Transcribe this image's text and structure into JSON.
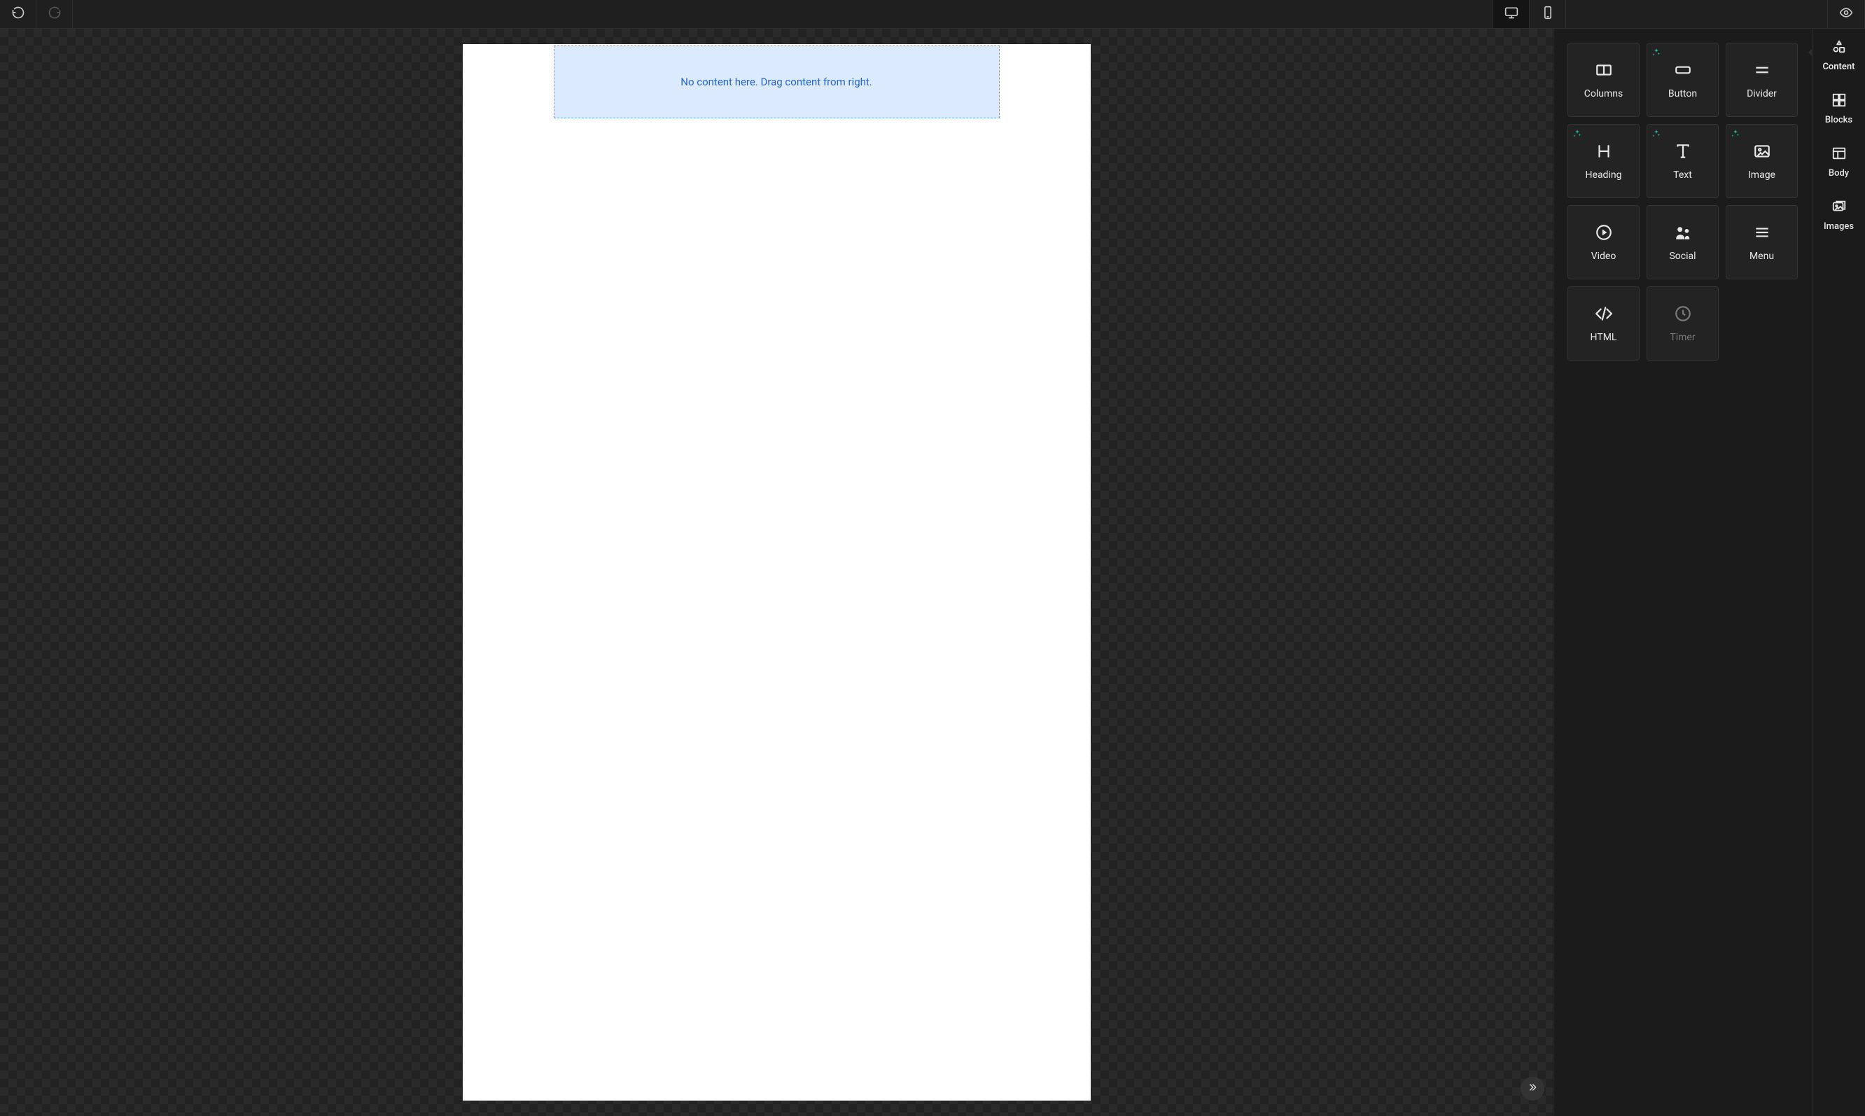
{
  "canvas": {
    "drop_message": "No content here. Drag content from right."
  },
  "sidebar_tabs": {
    "content": "Content",
    "blocks": "Blocks",
    "body": "Body",
    "images": "Images"
  },
  "blocks": {
    "columns": "Columns",
    "button": "Button",
    "divider": "Divider",
    "heading": "Heading",
    "text": "Text",
    "image": "Image",
    "video": "Video",
    "social": "Social",
    "menu": "Menu",
    "html": "HTML",
    "timer": "Timer"
  }
}
